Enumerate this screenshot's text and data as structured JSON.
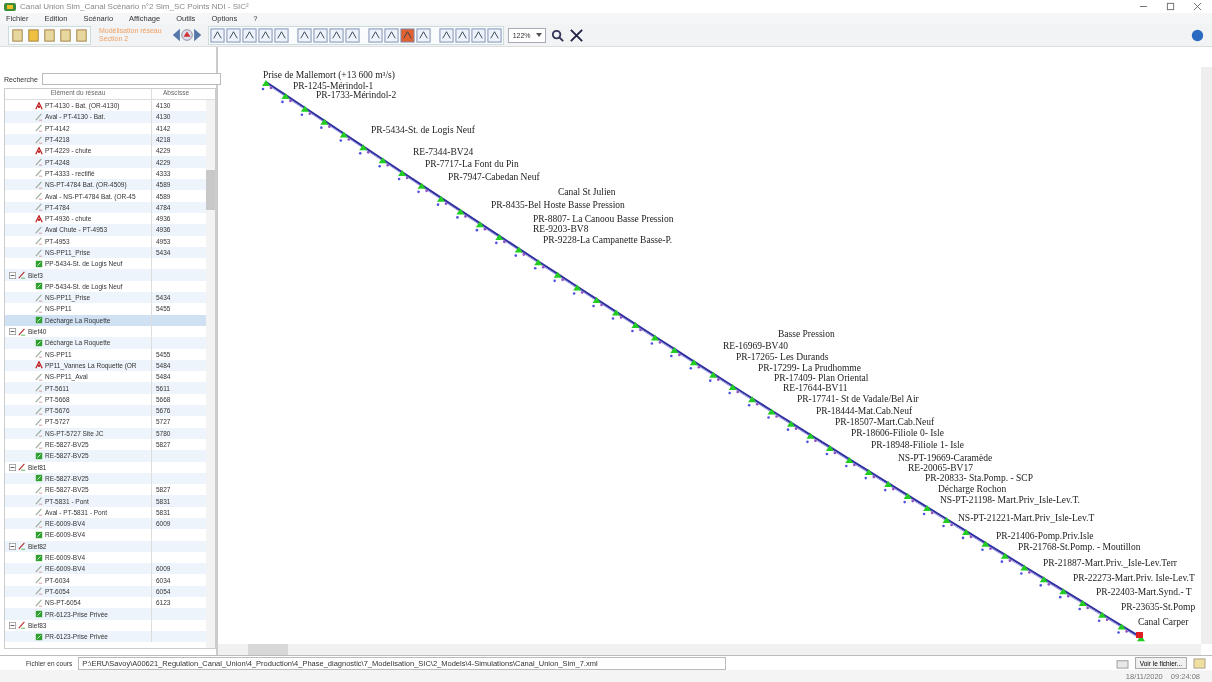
{
  "window": {
    "title": "Canal Union Sim_Canal Scénario n°2 Sim_SC Points NDI - SIC²"
  },
  "menu": [
    {
      "label": "Fichier"
    },
    {
      "label": "Edition"
    },
    {
      "label": "Scénario"
    },
    {
      "label": "Affichage"
    },
    {
      "label": "Outils"
    },
    {
      "label": "Options"
    },
    {
      "label": "?"
    }
  ],
  "toolbar": {
    "mode_title": "Modélisation réseau",
    "mode_subtitle": "Section 2",
    "zoom": "122%"
  },
  "search": {
    "label": "Recherche"
  },
  "tree": {
    "columns": [
      "Elément du réseau",
      "Abscisse"
    ],
    "items": [
      {
        "label": "PT-4130 - Bat. (OR-4130)",
        "abscissa": "4130",
        "kind": "structure",
        "selected": false
      },
      {
        "label": "Aval - PT-4130 - Bat.",
        "abscissa": "4130",
        "kind": "section",
        "selected": false
      },
      {
        "label": "PT-4142",
        "abscissa": "4142",
        "kind": "section",
        "selected": false
      },
      {
        "label": "PT-4218",
        "abscissa": "4218",
        "kind": "section",
        "selected": false
      },
      {
        "label": "PT-4229 - chute",
        "abscissa": "4229",
        "kind": "structure",
        "selected": false
      },
      {
        "label": "PT-4248",
        "abscissa": "4229",
        "kind": "section",
        "selected": false
      },
      {
        "label": "PT-4333 - rectifié",
        "abscissa": "4333",
        "kind": "section",
        "selected": false
      },
      {
        "label": "NS-PT-4784 Bat. (OR-4509)",
        "abscissa": "4589",
        "kind": "section",
        "selected": false
      },
      {
        "label": "Aval - NS-PT-4784 Bat. (OR-45",
        "abscissa": "4589",
        "kind": "section",
        "selected": false
      },
      {
        "label": "PT-4784",
        "abscissa": "4784",
        "kind": "section",
        "selected": false
      },
      {
        "label": "PT-4936 - chute",
        "abscissa": "4936",
        "kind": "structure",
        "selected": false
      },
      {
        "label": "Aval Chute - PT-4953",
        "abscissa": "4936",
        "kind": "section",
        "selected": false
      },
      {
        "label": "PT-4953",
        "abscissa": "4953",
        "kind": "section",
        "selected": false
      },
      {
        "label": "NS-PP11_Prise",
        "abscissa": "5434",
        "kind": "section",
        "selected": false
      },
      {
        "label": "PP-5434-St. de Logis Neuf",
        "kind": "node",
        "selected": false
      },
      {
        "label": "Bief3",
        "kind": "reach",
        "selected": false,
        "expanded": true,
        "children": [
          {
            "label": "PP-5434-St. de Logis Neuf",
            "kind": "node",
            "selected": false
          },
          {
            "label": "NS-PP11_Prise",
            "abscissa": "5434",
            "kind": "section",
            "selected": false
          },
          {
            "label": "NS-PP11",
            "abscissa": "5455",
            "kind": "section",
            "selected": false
          },
          {
            "label": "Décharge La Roquette",
            "kind": "node",
            "selected": true
          }
        ]
      },
      {
        "label": "Bief40",
        "kind": "reach",
        "selected": false,
        "expanded": true,
        "children": [
          {
            "label": "Décharge La Roquette",
            "kind": "node",
            "selected": false
          },
          {
            "label": "NS-PP11",
            "abscissa": "5455",
            "kind": "section",
            "selected": false
          },
          {
            "label": "PP11_Vannes La Roquette (OR",
            "abscissa": "5484",
            "kind": "structure",
            "selected": false
          },
          {
            "label": "NS-PP11_Aval",
            "abscissa": "5484",
            "kind": "section",
            "selected": false
          },
          {
            "label": "PT-5611",
            "abscissa": "5611",
            "kind": "section",
            "selected": false
          },
          {
            "label": "PT-5668",
            "abscissa": "5668",
            "kind": "section",
            "selected": false
          },
          {
            "label": "PT-5676",
            "abscissa": "5676",
            "kind": "section",
            "selected": false
          },
          {
            "label": "PT-5727",
            "abscissa": "5727",
            "kind": "section",
            "selected": false
          },
          {
            "label": "NS-PT-5727 Site JC",
            "abscissa": "5780",
            "kind": "section",
            "selected": false
          },
          {
            "label": "RE-5827-BV25",
            "abscissa": "5827",
            "kind": "section",
            "selected": false
          },
          {
            "label": "RE-5827-BV25",
            "kind": "node",
            "selected": false
          }
        ]
      },
      {
        "label": "Bief81",
        "kind": "reach",
        "selected": false,
        "expanded": true,
        "children": [
          {
            "label": "RE-5827-BV25",
            "kind": "node",
            "selected": false
          },
          {
            "label": "RE-5827-BV25",
            "abscissa": "5827",
            "kind": "section",
            "selected": false
          },
          {
            "label": "PT-5831 - Pont",
            "abscissa": "5831",
            "kind": "section",
            "selected": false
          },
          {
            "label": "Aval - PT-5831 - Pont",
            "abscissa": "5831",
            "kind": "section",
            "selected": false
          },
          {
            "label": "RE-6009-BV4",
            "abscissa": "6009",
            "kind": "section",
            "selected": false
          },
          {
            "label": "RE-6009-BV4",
            "kind": "node",
            "selected": false
          }
        ]
      },
      {
        "label": "Bief82",
        "kind": "reach",
        "selected": false,
        "expanded": true,
        "children": [
          {
            "label": "RE-6009-BV4",
            "kind": "node",
            "selected": false
          },
          {
            "label": "RE-6009-BV4",
            "abscissa": "6009",
            "kind": "section",
            "selected": false
          },
          {
            "label": "PT-6034",
            "abscissa": "6034",
            "kind": "section",
            "selected": false
          },
          {
            "label": "PT-6054",
            "abscissa": "6054",
            "kind": "section",
            "selected": false
          },
          {
            "label": "NS-PT-6054",
            "abscissa": "6123",
            "kind": "section",
            "selected": false
          },
          {
            "label": "PR-6123-Prise Privée",
            "kind": "node",
            "selected": false
          }
        ]
      },
      {
        "label": "Bief83",
        "kind": "reach",
        "selected": false,
        "expanded": true,
        "children": [
          {
            "label": "PR-6123-Prise Privée",
            "kind": "node",
            "selected": false
          }
        ]
      }
    ]
  },
  "canvas": {
    "labels": [
      "Prise de Mallemort (+13 600 m³/s)",
      "PR-1245-Mérindol-1",
      "PR-1733-Mérindol-2",
      "PR-5434-St. de Logis Neuf",
      "RE-7344-BV24",
      "PR-7717-La Font du Pin",
      "PR-7947-Cabedan Neuf",
      "Canal St Julien",
      "PR-8435-Bel Hoste Basse Pression",
      "PR-8807- La Canoou Basse Pression",
      "RE-9203-BV8",
      "PR-9228-La Campanette Basse-P.",
      "Basse Pression",
      "RE-16969-BV40",
      "PR-17265- Les Durands",
      "PR-17299- La Prudhomme",
      "PR-17409- Plan Oriental",
      "RE-17644-BV11",
      "PR-17741- St de Vadale/Bel Air",
      "PR-18444-Mat.Cab.Neuf",
      "PR-18507-Mart.Cab.Neuf",
      "PR-18606-Filiole 0- Isle",
      "PR-18948-Filiole 1- Isle",
      "NS-PT-19669-Caramède",
      "RE-20065-BV17",
      "PR-20833- Sta.Pomp. - SCP",
      "Décharge Rochon",
      "NS-PT-21198- Mart.Priv_Isle-Lev.T.",
      "NS-PT-21221-Mart.Priv_Isle-Lev.T",
      "PR-21406-Pomp.Priv.Isle",
      "PR-21768-St.Pomp. - Moutillon",
      "PR-21887-Mart.Priv._Isle-Lev.Terr",
      "PR-22273-Mart.Priv. Isle-Lev.T",
      "PR-22403-Mart.Synd.- T",
      "PR-23635-St.Pomp",
      "Canal Carper"
    ]
  },
  "status": {
    "label": "Fichier en cours",
    "path": "P:\\ERU\\Savoy\\A00621_Regulation_Canal_Union\\4_Production\\4_Phase_diagnostic\\7_Modelisation_SIC\\2_Models\\4-Simulations\\Canal_Union_Sim_7.xml",
    "view_button": "Voir le fichier...",
    "date": "18/11/2020",
    "time": "09:24:08"
  }
}
